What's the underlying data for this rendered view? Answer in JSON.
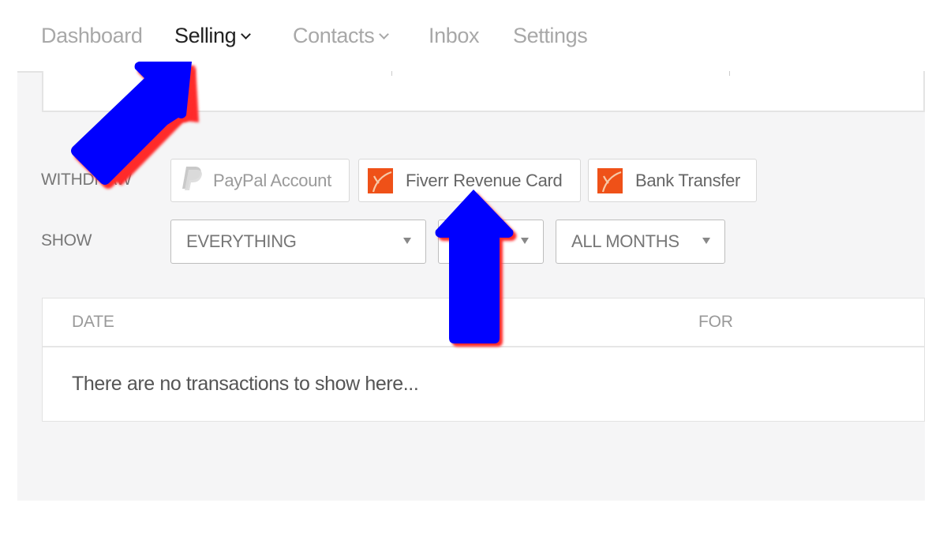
{
  "nav": {
    "items": [
      {
        "label": "Dashboard",
        "active": false,
        "has_dropdown": false
      },
      {
        "label": "Selling",
        "active": true,
        "has_dropdown": true
      },
      {
        "label": "Contacts",
        "active": false,
        "has_dropdown": true
      },
      {
        "label": "Inbox",
        "active": false,
        "has_dropdown": false
      },
      {
        "label": "Settings",
        "active": false,
        "has_dropdown": false
      }
    ]
  },
  "withdraw": {
    "label": "WITHDRAW",
    "methods": [
      {
        "label": "PayPal Account",
        "icon": "paypal-icon",
        "enabled": false
      },
      {
        "label": "Fiverr Revenue Card",
        "icon": "fiverr-icon",
        "enabled": true
      },
      {
        "label": "Bank Transfer",
        "icon": "fiverr-icon",
        "enabled": true
      }
    ]
  },
  "show": {
    "label": "SHOW",
    "filters": [
      {
        "value": "EVERYTHING"
      },
      {
        "value": ""
      },
      {
        "value": "ALL MONTHS"
      }
    ]
  },
  "table": {
    "columns": [
      "DATE",
      "FOR"
    ],
    "empty_message": "There are no transactions to show here..."
  },
  "colors": {
    "fiverr_orange": "#ef5118",
    "annotation_arrow": "#0000ff",
    "arrow_shadow": "#ff2a2a"
  },
  "annotations": [
    {
      "type": "arrow",
      "points_to": "Selling"
    },
    {
      "type": "arrow",
      "points_to": "Fiverr Revenue Card"
    }
  ]
}
